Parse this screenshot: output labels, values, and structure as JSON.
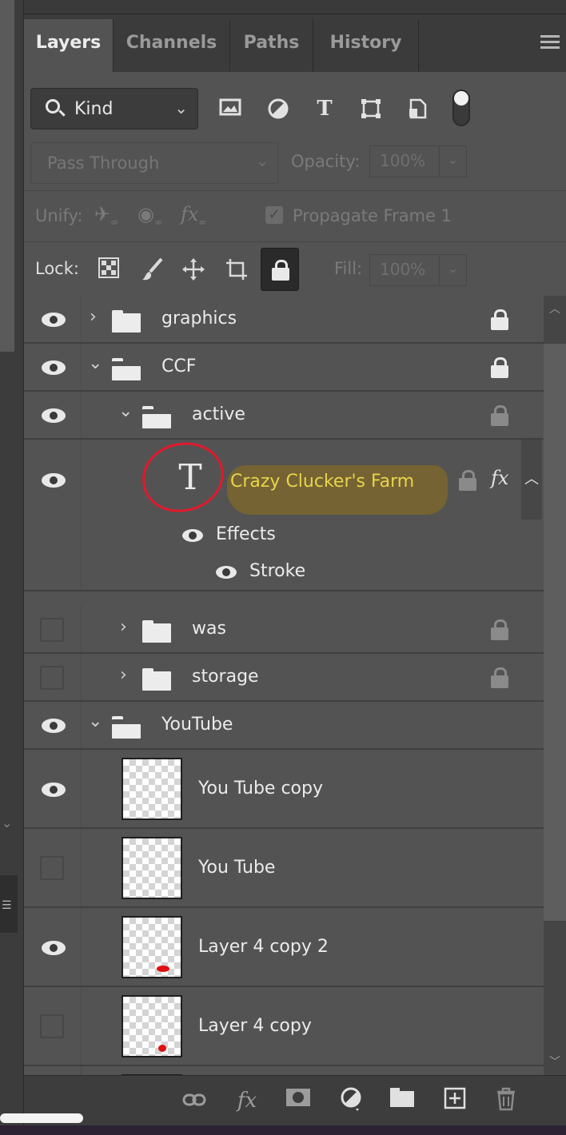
{
  "tabs": [
    {
      "label": "Layers",
      "active": true
    },
    {
      "label": "Channels",
      "active": false
    },
    {
      "label": "Paths",
      "active": false
    },
    {
      "label": "History",
      "active": false
    }
  ],
  "filter": {
    "kind_label": "Kind",
    "icons": [
      "pixel-layer-filter-icon",
      "adjustment-layer-filter-icon",
      "type-layer-filter-icon",
      "shape-layer-filter-icon",
      "smart-object-filter-icon"
    ]
  },
  "blend": {
    "mode": "Pass Through",
    "opacity_label": "Opacity:",
    "opacity_value": "100%"
  },
  "unify": {
    "label": "Unify:",
    "propagate_label": "Propagate Frame 1"
  },
  "lock": {
    "label": "Lock:",
    "fill_label": "Fill:",
    "fill_value": "100%"
  },
  "layers": [
    {
      "name": "graphics",
      "type": "group",
      "visible": true,
      "expanded": false
    },
    {
      "name": "CCF",
      "type": "group",
      "visible": true,
      "expanded": true
    },
    {
      "name": "active",
      "type": "group",
      "visible": true,
      "expanded": true
    },
    {
      "name": "Crazy Clucker's Farm",
      "type": "text",
      "visible": true,
      "has_fx": true,
      "name_color": "#e8d44a"
    },
    {
      "name": "was",
      "type": "group",
      "visible": false,
      "expanded": false
    },
    {
      "name": "storage",
      "type": "group",
      "visible": false,
      "expanded": false
    },
    {
      "name": "YouTube",
      "type": "group",
      "visible": true,
      "expanded": true
    },
    {
      "name": "You Tube copy",
      "type": "pixel",
      "visible": true
    },
    {
      "name": "You Tube",
      "type": "pixel",
      "visible": false
    },
    {
      "name": "Layer 4 copy 2",
      "type": "pixel",
      "visible": true
    },
    {
      "name": "Layer 4 copy",
      "type": "pixel",
      "visible": false
    }
  ],
  "effects": {
    "effects_label": "Effects",
    "stroke_label": "Stroke"
  },
  "annotation": {
    "circle_color": "#e2192b",
    "highlight_color": "#806828"
  },
  "bottom_toolbar": [
    "link-layers-icon",
    "add-style-icon",
    "add-mask-icon",
    "new-fill-adjustment-icon",
    "new-group-icon",
    "new-layer-icon",
    "delete-layer-icon"
  ]
}
